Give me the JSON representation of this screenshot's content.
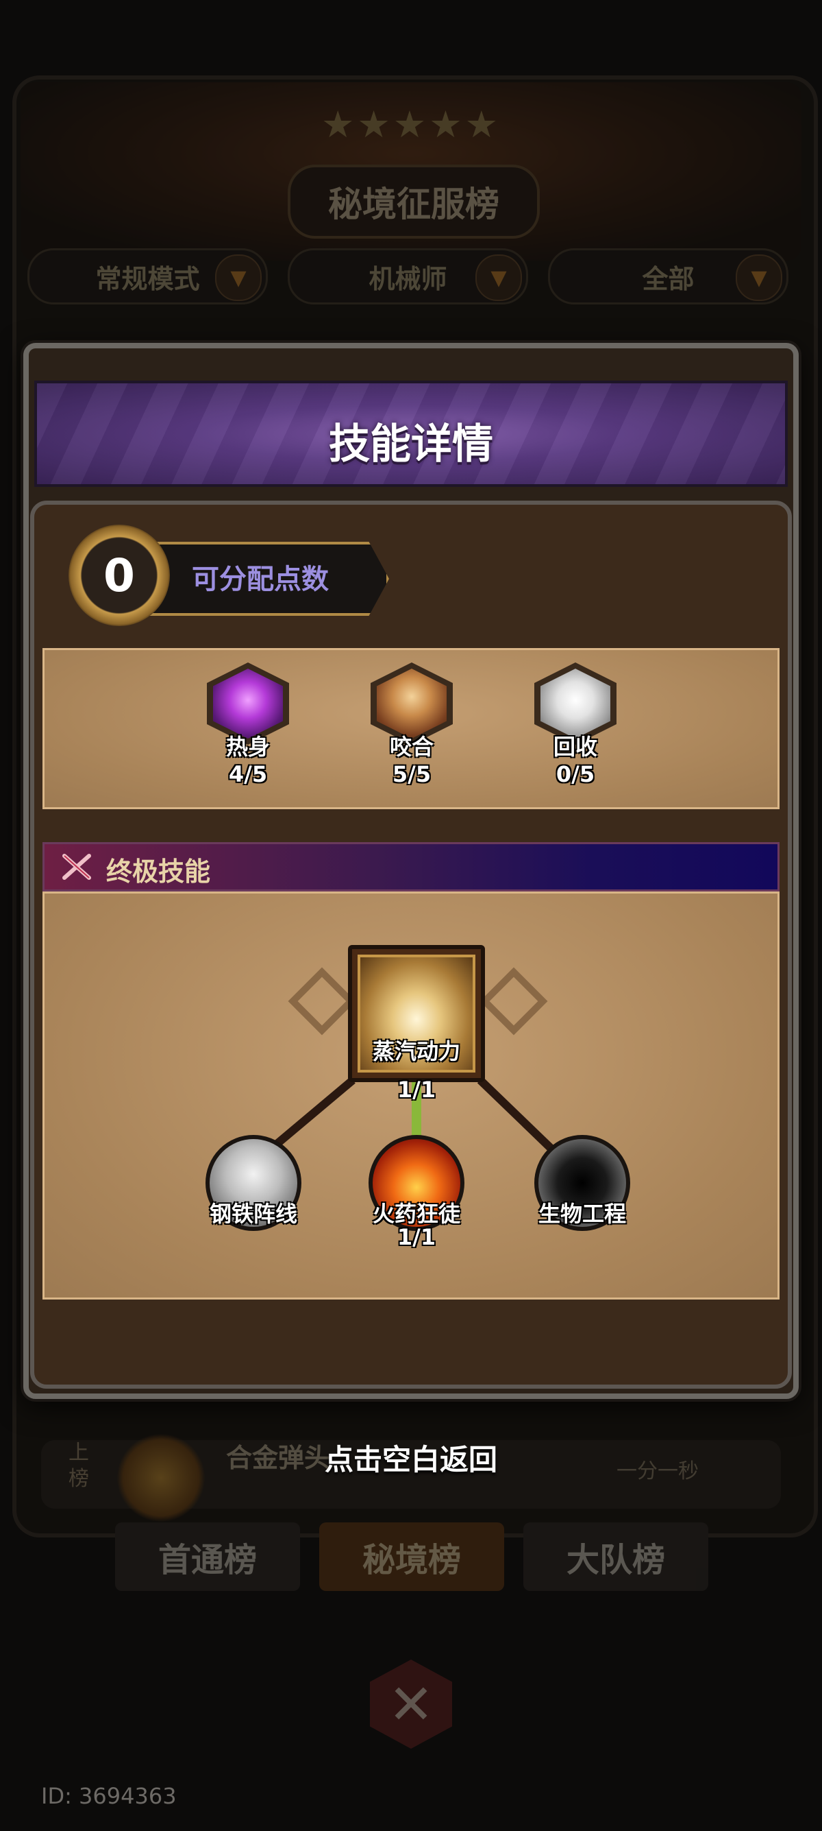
{
  "background": {
    "leaderboard_title": "秘境征服榜",
    "filters": [
      "常规模式",
      "机械师",
      "全部"
    ],
    "rank_side_label": "上榜",
    "rank_text": "合金弹头",
    "rank_time": "一分一秒",
    "tabs": [
      "首通榜",
      "秘境榜",
      "大队榜"
    ],
    "active_tab": "秘境榜",
    "user_id": "ID: 3694363"
  },
  "modal": {
    "title": "技能详情",
    "points_value": "0",
    "points_label": "可分配点数",
    "basic_skills": [
      {
        "name": "热身",
        "level": "4/5",
        "icon": "purple-flame-figure-icon"
      },
      {
        "name": "咬合",
        "level": "5/5",
        "icon": "up-arrow-burst-icon"
      },
      {
        "name": "回收",
        "level": "0/5",
        "icon": "white-swirl-icon"
      }
    ],
    "ultimate_section_label": "终极技能",
    "ultimate_tree": {
      "root": {
        "name": "蒸汽动力",
        "level": "1/1",
        "icon": "steam-vortex-icon"
      },
      "children": [
        {
          "name": "钢铁阵线",
          "level": "",
          "icon": "steel-soldier-icon",
          "linked": false
        },
        {
          "name": "火药狂徒",
          "level": "1/1",
          "icon": "gunpowder-fire-icon",
          "linked": true
        },
        {
          "name": "生物工程",
          "level": "",
          "icon": "dark-orb-icon",
          "linked": false
        }
      ]
    },
    "dismiss_hint": "点击空白返回"
  },
  "colors": {
    "header_purple": "#5a3a82",
    "link_active": "#8ab83a",
    "link_inactive": "#2a1810",
    "points_label": "#9c8fe0"
  }
}
